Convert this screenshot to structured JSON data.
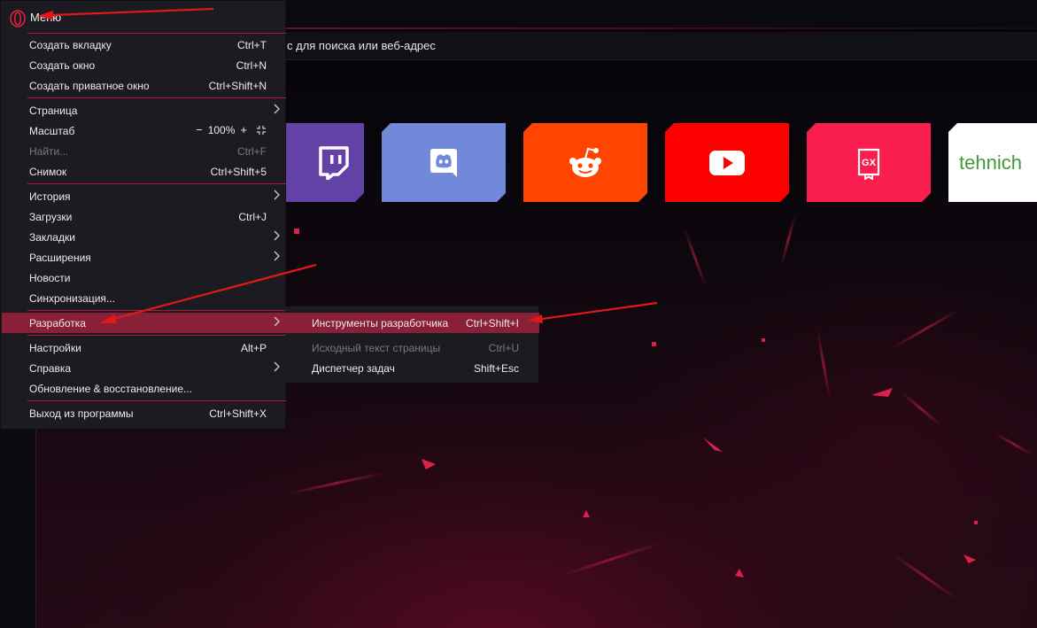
{
  "address_bar": {
    "placeholder": "с для поиска или веб-адрес"
  },
  "menu": {
    "title": "Меню",
    "items": [
      {
        "label": "Создать вкладку",
        "shortcut": "Ctrl+T"
      },
      {
        "label": "Создать окно",
        "shortcut": "Ctrl+N"
      },
      {
        "label": "Создать приватное окно",
        "shortcut": "Ctrl+Shift+N"
      },
      {
        "label": "Страница",
        "shortcut": "",
        "submenu": true
      },
      {
        "label": "Масштаб",
        "zoom": {
          "minus": "−",
          "value": "100%",
          "plus": "+"
        }
      },
      {
        "label": "Найти...",
        "shortcut": "Ctrl+F",
        "disabled": true
      },
      {
        "label": "Снимок",
        "shortcut": "Ctrl+Shift+5"
      },
      {
        "label": "История",
        "submenu": true
      },
      {
        "label": "Загрузки",
        "shortcut": "Ctrl+J"
      },
      {
        "label": "Закладки",
        "submenu": true
      },
      {
        "label": "Расширения",
        "submenu": true
      },
      {
        "label": "Новости"
      },
      {
        "label": "Синхронизация..."
      },
      {
        "label": "Разработка",
        "submenu": true,
        "highlighted": true
      },
      {
        "label": "Настройки",
        "shortcut": "Alt+P"
      },
      {
        "label": "Справка",
        "submenu": true
      },
      {
        "label": "Обновление & восстановление..."
      },
      {
        "label": "Выход из программы",
        "shortcut": "Ctrl+Shift+X"
      }
    ]
  },
  "submenu_development": {
    "items": [
      {
        "label": "Инструменты разработчика",
        "shortcut": "Ctrl+Shift+I",
        "highlighted": true
      },
      {
        "label": "Исходный текст страницы",
        "shortcut": "Ctrl+U",
        "disabled": true
      },
      {
        "label": "Диспетчер задач",
        "shortcut": "Shift+Esc"
      }
    ]
  },
  "speed_dial": {
    "tiles": [
      {
        "name": "twitch",
        "icon": "twitch-icon",
        "color": "#6441a5"
      },
      {
        "name": "discord",
        "icon": "discord-icon",
        "color": "#7289da"
      },
      {
        "name": "reddit",
        "icon": "reddit-icon",
        "color": "#ff4500"
      },
      {
        "name": "youtube",
        "icon": "youtube-icon",
        "color": "#ff0000"
      },
      {
        "name": "gx",
        "icon": "gx-icon",
        "color": "#fa1e4e"
      },
      {
        "name": "tehnichka",
        "text": "tehnich",
        "color": "#ffffff"
      }
    ]
  },
  "colors": {
    "accent": "#b0183c",
    "highlight": "#8a1f38",
    "menu_bg": "#1c1b22",
    "annotation_arrow": "#e01818"
  }
}
